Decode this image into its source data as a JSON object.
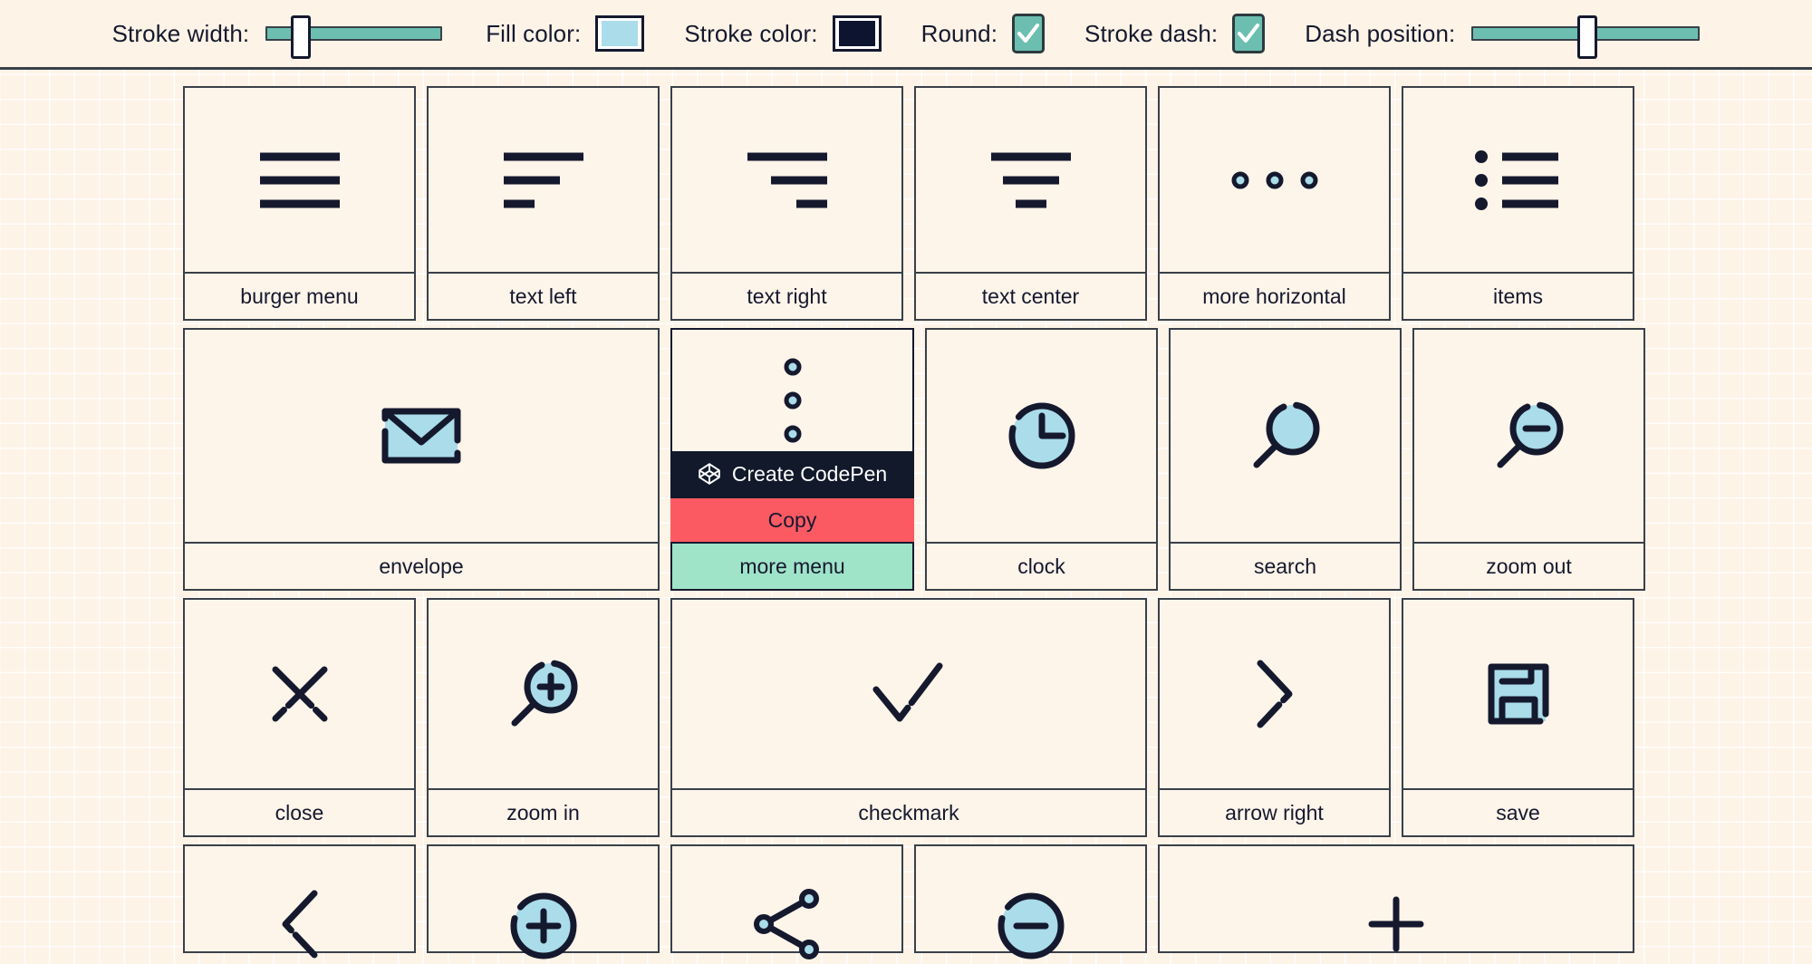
{
  "toolbar": {
    "controls": [
      {
        "name": "stroke-width",
        "label": "Stroke width:",
        "type": "slider",
        "value": 14
      },
      {
        "name": "fill-color",
        "label": "Fill color:",
        "type": "color",
        "value": "#aadcea"
      },
      {
        "name": "stroke-color",
        "label": "Stroke color:",
        "type": "color",
        "value": "#0d1430"
      },
      {
        "name": "round",
        "label": "Round:",
        "type": "checkbox",
        "checked": true
      },
      {
        "name": "stroke-dash",
        "label": "Stroke dash:",
        "type": "checkbox",
        "checked": true
      },
      {
        "name": "dash-position",
        "label": "Dash position:",
        "type": "slider",
        "value": 46
      }
    ],
    "accent_color": "#6cbfb0",
    "checkmark_color": "#ffffff"
  },
  "gallery": {
    "rows": [
      {
        "cells": [
          {
            "label": "burger menu",
            "icon": "burger-menu-icon"
          },
          {
            "label": "text left",
            "icon": "text-left-icon"
          },
          {
            "label": "text right",
            "icon": "text-right-icon"
          },
          {
            "label": "text center",
            "icon": "text-center-icon"
          },
          {
            "label": "more horizontal",
            "icon": "more-horizontal-icon"
          },
          {
            "label": "items",
            "icon": "items-icon"
          }
        ]
      },
      {
        "cells": [
          {
            "label": "envelope",
            "icon": "envelope-icon"
          },
          {
            "label": "more menu",
            "icon": "more-vertical-icon",
            "hovered": true
          },
          {
            "label": "clock",
            "icon": "clock-icon"
          },
          {
            "label": "search",
            "icon": "search-icon"
          },
          {
            "label": "zoom out",
            "icon": "zoom-out-icon"
          }
        ]
      },
      {
        "cells": [
          {
            "label": "close",
            "icon": "close-icon"
          },
          {
            "label": "zoom in",
            "icon": "zoom-in-icon"
          },
          {
            "label": "checkmark",
            "icon": "checkmark-icon"
          },
          {
            "label": "arrow right",
            "icon": "arrow-right-icon"
          },
          {
            "label": "save",
            "icon": "save-icon"
          }
        ]
      },
      {
        "cells": [
          {
            "label": "",
            "icon": "arrow-left-icon"
          },
          {
            "label": "",
            "icon": "plus-circle-icon"
          },
          {
            "label": "",
            "icon": "share-icon"
          },
          {
            "label": "",
            "icon": "minus-circle-icon"
          },
          {
            "label": "",
            "icon": "plus-icon"
          }
        ]
      }
    ]
  },
  "context_menu": {
    "codepen_label": "Create CodePen",
    "copy_label": "Copy",
    "codepen_bg": "#11192b",
    "copy_bg": "#fb5a63",
    "caption_bg": "#9fe3c9"
  }
}
